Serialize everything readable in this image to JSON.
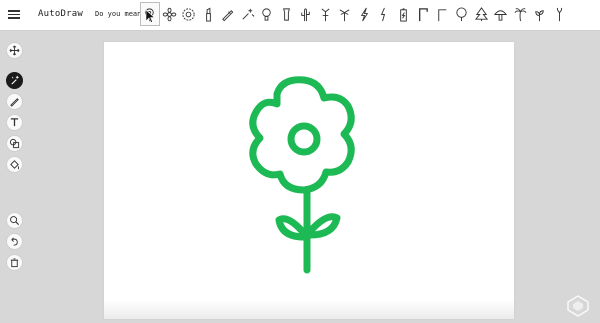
{
  "app": {
    "title": "AutoDraw"
  },
  "suggestions": {
    "label": "Do you mean:",
    "items": [
      {
        "name": "flower-outline-icon",
        "selected": true
      },
      {
        "name": "daisy-icon"
      },
      {
        "name": "sunflower-icon"
      },
      {
        "name": "lipstick-icon"
      },
      {
        "name": "pencil-icon"
      },
      {
        "name": "sparkle-hand-icon"
      },
      {
        "name": "lightbulb-icon"
      },
      {
        "name": "flashlight-icon"
      },
      {
        "name": "cactus-icon"
      },
      {
        "name": "antenna-icon"
      },
      {
        "name": "palm-sketch-icon"
      },
      {
        "name": "lightning-icon"
      },
      {
        "name": "bolt-icon"
      },
      {
        "name": "battery-icon"
      },
      {
        "name": "crane-icon"
      },
      {
        "name": "corner-icon"
      },
      {
        "name": "tree-icon"
      },
      {
        "name": "pine-tree-icon"
      },
      {
        "name": "mushroom-icon"
      },
      {
        "name": "palm-tree-icon"
      },
      {
        "name": "sprout-icon"
      },
      {
        "name": "seedling-icon"
      }
    ]
  },
  "toolbar": {
    "items": [
      {
        "name": "move-icon"
      },
      {
        "name": "autodraw-icon",
        "active": true
      },
      {
        "name": "draw-icon"
      },
      {
        "name": "type-icon"
      },
      {
        "name": "shape-icon"
      },
      {
        "name": "fill-icon"
      },
      {
        "name": "zoom-icon"
      },
      {
        "name": "undo-icon"
      },
      {
        "name": "delete-icon"
      }
    ]
  },
  "colors": {
    "drawing": "#1db954",
    "accent": "#1a1a1a"
  }
}
